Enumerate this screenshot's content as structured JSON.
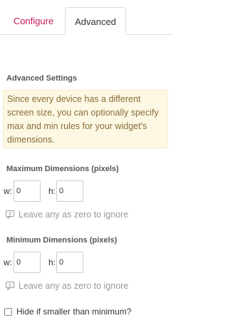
{
  "tabs": {
    "configure_label": "Configure",
    "advanced_label": "Advanced"
  },
  "advanced": {
    "title": "Advanced Settings",
    "notice": "Since every device has a different screen size, you can optionally specify max and min rules for your widget's dimensions."
  },
  "max_dims": {
    "title": "Maximum Dimensions (pixels)",
    "w_label": "w:",
    "h_label": "h:",
    "w_value": "0",
    "h_value": "0",
    "hint": "Leave any as zero to ignore"
  },
  "min_dims": {
    "title": "Minimum Dimensions (pixels)",
    "w_label": "w:",
    "h_label": "h:",
    "w_value": "0",
    "h_value": "0",
    "hint": "Leave any as zero to ignore"
  },
  "hide_option": {
    "label": "Hide if smaller than minimum?",
    "checked": false
  },
  "colors": {
    "accent": "#c2185b",
    "notice_bg": "#fcf8e3",
    "notice_text": "#8a6d3b",
    "hint_text": "#999999"
  },
  "icons": {
    "hint_icon": "info-tooltip-icon"
  }
}
